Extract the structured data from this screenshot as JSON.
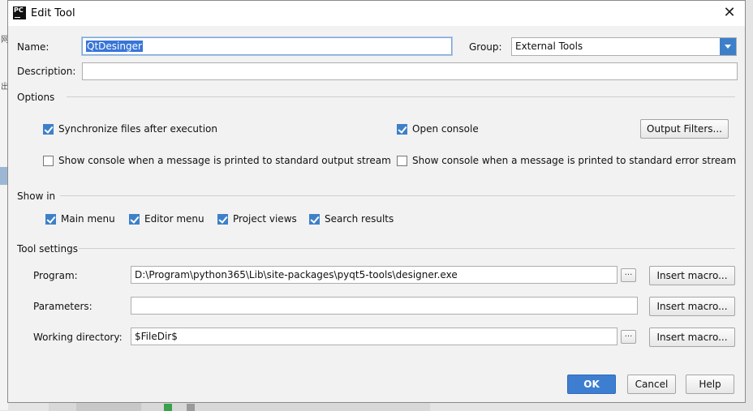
{
  "dialog": {
    "title": "Edit Tool",
    "app_icon_text": "PC",
    "close_glyph": "✕"
  },
  "name": {
    "label": "Name:",
    "value": "QtDesinger"
  },
  "group": {
    "label": "Group:",
    "value": "External Tools"
  },
  "description": {
    "label": "Description:",
    "value": ""
  },
  "options": {
    "title": "Options",
    "sync_files": {
      "label": "Synchronize files after execution",
      "checked": true
    },
    "open_console": {
      "label": "Open console",
      "checked": true
    },
    "output_filters_button": "Output Filters...",
    "show_console_stdout": {
      "label": "Show console when a message is printed to standard output stream",
      "checked": false
    },
    "show_console_stderr": {
      "label": "Show console when a message is printed to standard error stream",
      "checked": false
    }
  },
  "show_in": {
    "title": "Show in",
    "main_menu": {
      "label": "Main menu",
      "checked": true
    },
    "editor_menu": {
      "label": "Editor menu",
      "checked": true
    },
    "project_views": {
      "label": "Project views",
      "checked": true
    },
    "search_results": {
      "label": "Search results",
      "checked": true
    }
  },
  "tool_settings": {
    "title": "Tool settings",
    "program": {
      "label": "Program:",
      "value": "D:\\Program\\python365\\Lib\\site-packages\\pyqt5-tools\\designer.exe"
    },
    "parameters": {
      "label": "Parameters:",
      "value": ""
    },
    "working_directory": {
      "label": "Working directory:",
      "value": "$FileDir$"
    },
    "insert_macro_label": "Insert macro...",
    "browse_label": "..."
  },
  "footer": {
    "ok": "OK",
    "cancel": "Cancel",
    "help": "Help"
  },
  "colors": {
    "accent": "#3d80c9",
    "ok_button": "#3d7ed1",
    "dialog_bg": "#f2f2f2"
  },
  "icons": [
    "app-icon",
    "close-icon",
    "dropdown-arrow-icon",
    "checkbox-icon"
  ]
}
